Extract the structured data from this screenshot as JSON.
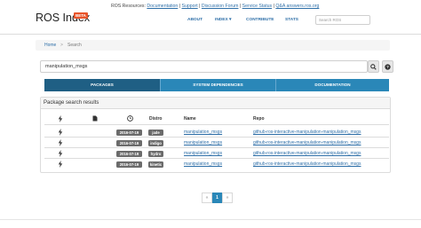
{
  "header": {
    "brand": "ROS Index",
    "beta": "BETA",
    "resources_prefix": "ROS Resources:",
    "resources": [
      "Documentation",
      "Support",
      "Discussion Forum",
      "Service Status",
      "Q&A answers.ros.org"
    ],
    "nav": {
      "about": "ABOUT",
      "index": "INDEX ▾",
      "contribute": "CONTRIBUTE",
      "stats": "STATS"
    },
    "search_placeholder": "Search ROS"
  },
  "breadcrumb": {
    "home": "Home",
    "sep": ">",
    "current": "Search"
  },
  "search": {
    "value": "manipulation_msgs"
  },
  "tabs": [
    "PACKAGES",
    "SYSTEM DEPENDENCIES",
    "DOCUMENTATION"
  ],
  "results": {
    "title": "Package search results",
    "columns": {
      "distro": "Distro",
      "name": "Name",
      "repo": "Repo"
    },
    "rows": [
      {
        "date": "2016-07-19",
        "distro": "jade",
        "name": "manipulation_msgs",
        "repo": "github-ros-interactive-manipulation-manipulation_msgs"
      },
      {
        "date": "2016-07-19",
        "distro": "indigo",
        "name": "manipulation_msgs",
        "repo": "github-ros-interactive-manipulation-manipulation_msgs"
      },
      {
        "date": "2016-07-19",
        "distro": "hydro",
        "name": "manipulation_msgs",
        "repo": "github-ros-interactive-manipulation-manipulation_msgs"
      },
      {
        "date": "2016-07-19",
        "distro": "kinetic",
        "name": "manipulation_msgs",
        "repo": "github-ros-interactive-manipulation-manipulation_msgs"
      }
    ]
  },
  "pagination": {
    "prev": "«",
    "current": "1",
    "next": "»"
  },
  "colors": {
    "accent": "#2a87b8",
    "accent_dark": "#1f5f84",
    "link": "#2e6fa8",
    "beta": "#e8542a",
    "badge": "#6b6b6b"
  },
  "icons": {
    "bolt": "bolt-icon",
    "doc": "document-icon",
    "clock": "clock-icon",
    "search": "search-icon",
    "help": "help-icon"
  }
}
